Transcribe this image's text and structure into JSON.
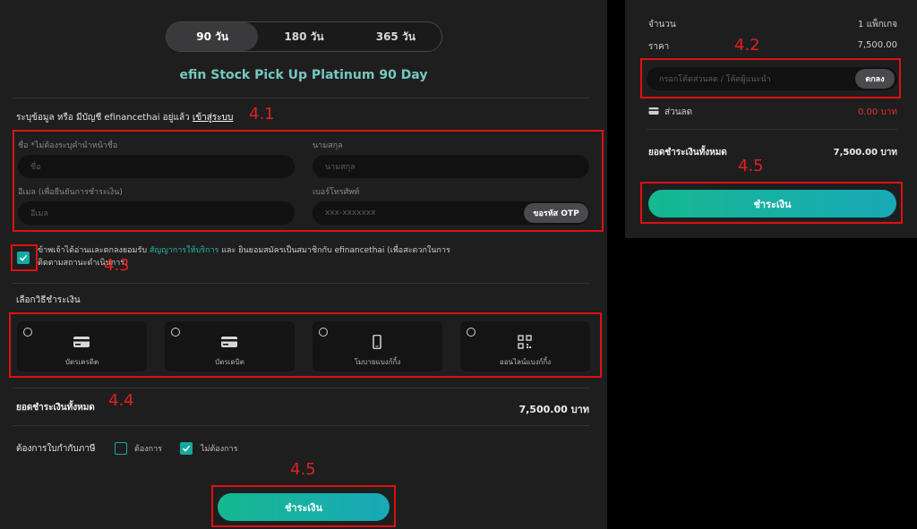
{
  "period_tabs": [
    "90 วัน",
    "180 วัน",
    "365 วัน"
  ],
  "plan_title": "efin Stock Pick Up Platinum 90 Day",
  "login_prompt": {
    "text": "ระบุข้อมูล หรือ มีบัญชี efinancethai อยู่แล้ว",
    "link": "เข้าสู่ระบบ"
  },
  "form": {
    "first_name_label": "ชื่อ *ไม่ต้องระบุคำนำหน้าชื่อ",
    "first_name_placeholder": "ชื่อ",
    "last_name_label": "นามสกุล",
    "last_name_placeholder": "นามสกุล",
    "email_label": "อีเมล (เพื่อยืนยันการชำระเงิน)",
    "email_placeholder": "อีเมล",
    "phone_label": "เบอร์โทรศัพท์",
    "phone_placeholder": "xxx-xxxxxxx",
    "otp_button": "ขอรหัส OTP"
  },
  "consent": {
    "prefix": "ข้าพเจ้าได้อ่านและตกลงยอมรับ",
    "terms_link": "สัญญาการให้บริการ",
    "suffix": "และ ยินยอมสมัครเป็นสมาชิกกับ efinancethai (เพื่อสะดวกในการติดตามสถานะดำเนินการ)"
  },
  "payment_section_title": "เลือกวิธีชำระเงิน",
  "payment_methods": [
    "บัตรเครดิต",
    "บัตรเดบิต",
    "โมบายแบงก์กิ้ง",
    "ออนไลน์แบงก์กิ้ง"
  ],
  "total": {
    "label": "ยอดชำระเงินทั้งหมด",
    "value": "7,500.00 บาท"
  },
  "tax_invoice": {
    "label": "ต้องการใบกำกับภาษี",
    "option_yes": "ต้องการ",
    "option_no": "ไม่ต้องการ"
  },
  "pay_button": "ชำระเงิน",
  "annotations": {
    "a41": "4.1",
    "a42": "4.2",
    "a43": "4.3",
    "a44": "4.4",
    "a45": "4.5"
  },
  "summary": {
    "qty_label": "จำนวน",
    "qty_value": "1 แพ็กเกจ",
    "price_label": "ราคา",
    "price_value": "7,500.00",
    "promo_placeholder": "กรอกโค้ดส่วนลด / โค้ดผู้แนะนำ",
    "promo_button": "ตกลง",
    "discount_label": "ส่วนลด",
    "discount_value": "0.00 บาท",
    "total_label": "ยอดชำระเงินทั้งหมด",
    "total_value": "7,500.00 บาท",
    "pay_button": "ชำระเงิน"
  },
  "colors": {
    "accent": "#17a8a0",
    "annotation_red": "#dd1111",
    "discount_red": "#e03030"
  }
}
